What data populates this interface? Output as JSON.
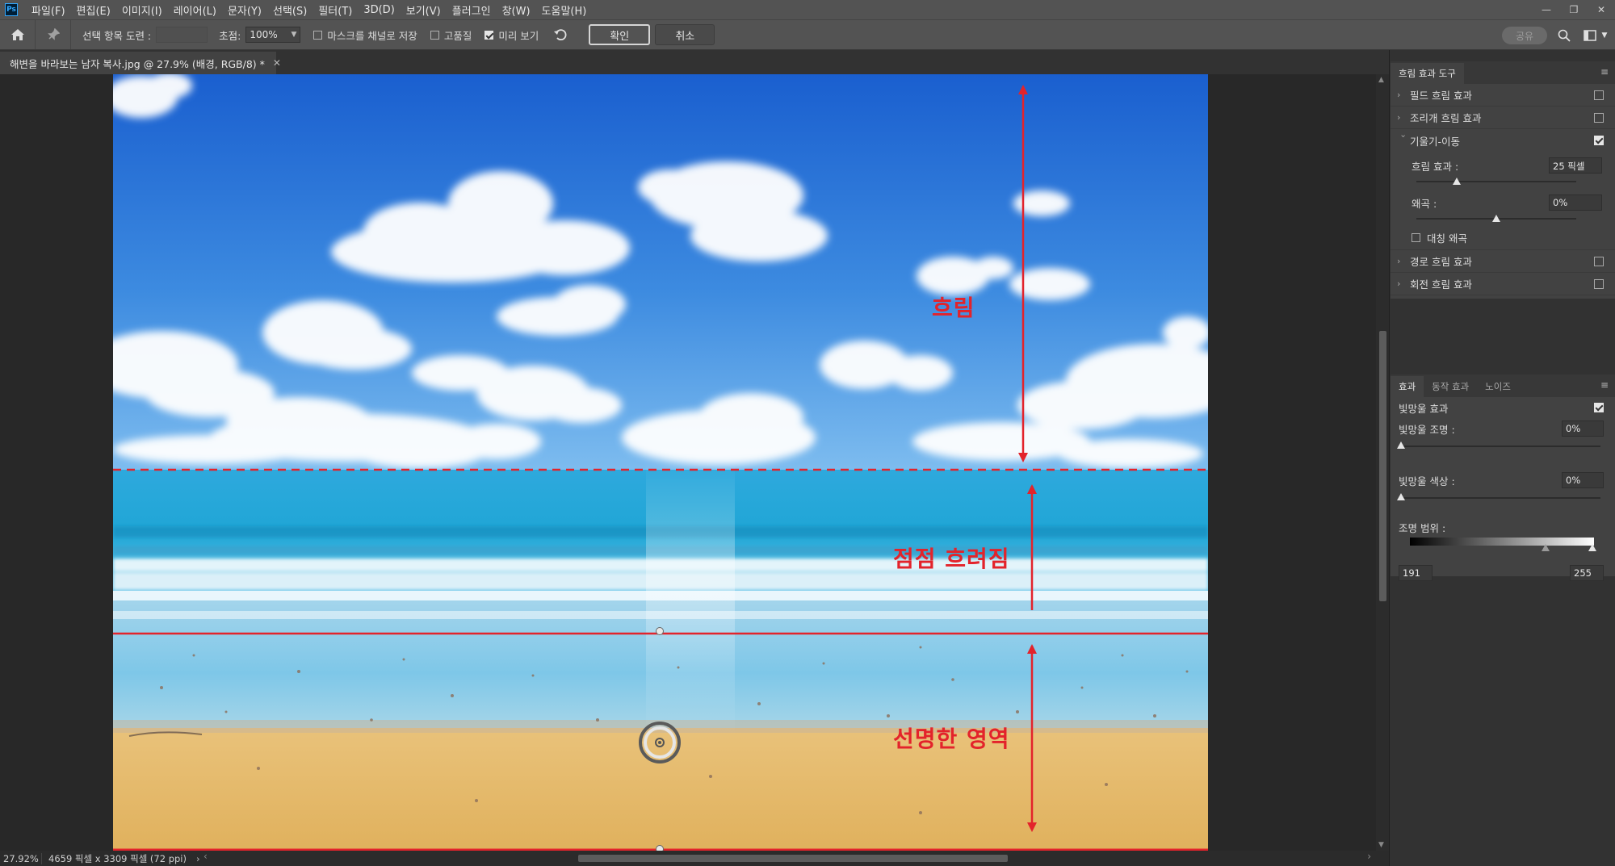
{
  "menu": {
    "items": [
      "파일(F)",
      "편집(E)",
      "이미지(I)",
      "레이어(L)",
      "문자(Y)",
      "선택(S)",
      "필터(T)",
      "3D(D)",
      "보기(V)",
      "플러그인",
      "창(W)",
      "도움말(H)"
    ]
  },
  "options": {
    "selection_label": "선택 항목 도련 :",
    "focus_label": "초점:",
    "focus_value": "100%",
    "save_mask_label": "마스크를 채널로 저장",
    "high_quality_label": "고품질",
    "preview_label": "미리 보기",
    "ok_label": "확인",
    "cancel_label": "취소",
    "share_label": "공유"
  },
  "document": {
    "tab_title": "해변을 바라보는 남자 복사.jpg @ 27.9% (배경, RGB/8) *"
  },
  "status": {
    "zoom": "27.92%",
    "info": "4659 픽셀 x 3309 픽셀 (72 ppi)"
  },
  "blur_panel": {
    "title": "흐림 효과 도구",
    "rows": [
      {
        "label": "필드 흐림 효과",
        "checked": false,
        "expanded": false
      },
      {
        "label": "조리개 흐림 효과",
        "checked": false,
        "expanded": false
      },
      {
        "label": "기울기-이동",
        "checked": true,
        "expanded": true
      },
      {
        "label": "경로 흐림 효과",
        "checked": false,
        "expanded": false
      },
      {
        "label": "회전 흐림 효과",
        "checked": false,
        "expanded": false
      }
    ],
    "tilt": {
      "blur_label": "흐림 효과 :",
      "blur_value": "25 픽셀",
      "blur_level": 0.25,
      "distortion_label": "왜곡 :",
      "distortion_value": "0%",
      "distortion_level": 0.5,
      "symmetric_label": "대칭 왜곡"
    }
  },
  "effects_panel": {
    "tabs": [
      "효과",
      "동작 효과",
      "노이즈"
    ],
    "bokeh_label": "빛망울 효과",
    "bokeh_checked": true,
    "bokeh_light_label": "빛망울 조명 :",
    "bokeh_light_value": "0%",
    "bokeh_color_label": "빛망울 색상 :",
    "bokeh_color_value": "0%",
    "light_range_label": "조명 범위 :",
    "range_low": "191",
    "range_high": "255"
  },
  "annotations": {
    "blur": "흐림",
    "gradual": "점점 흐려짐",
    "sharp": "선명한 영역"
  },
  "colors": {
    "annotation_red": "#e3232b",
    "panel_bg": "#424242",
    "chrome_bg": "#535353"
  }
}
